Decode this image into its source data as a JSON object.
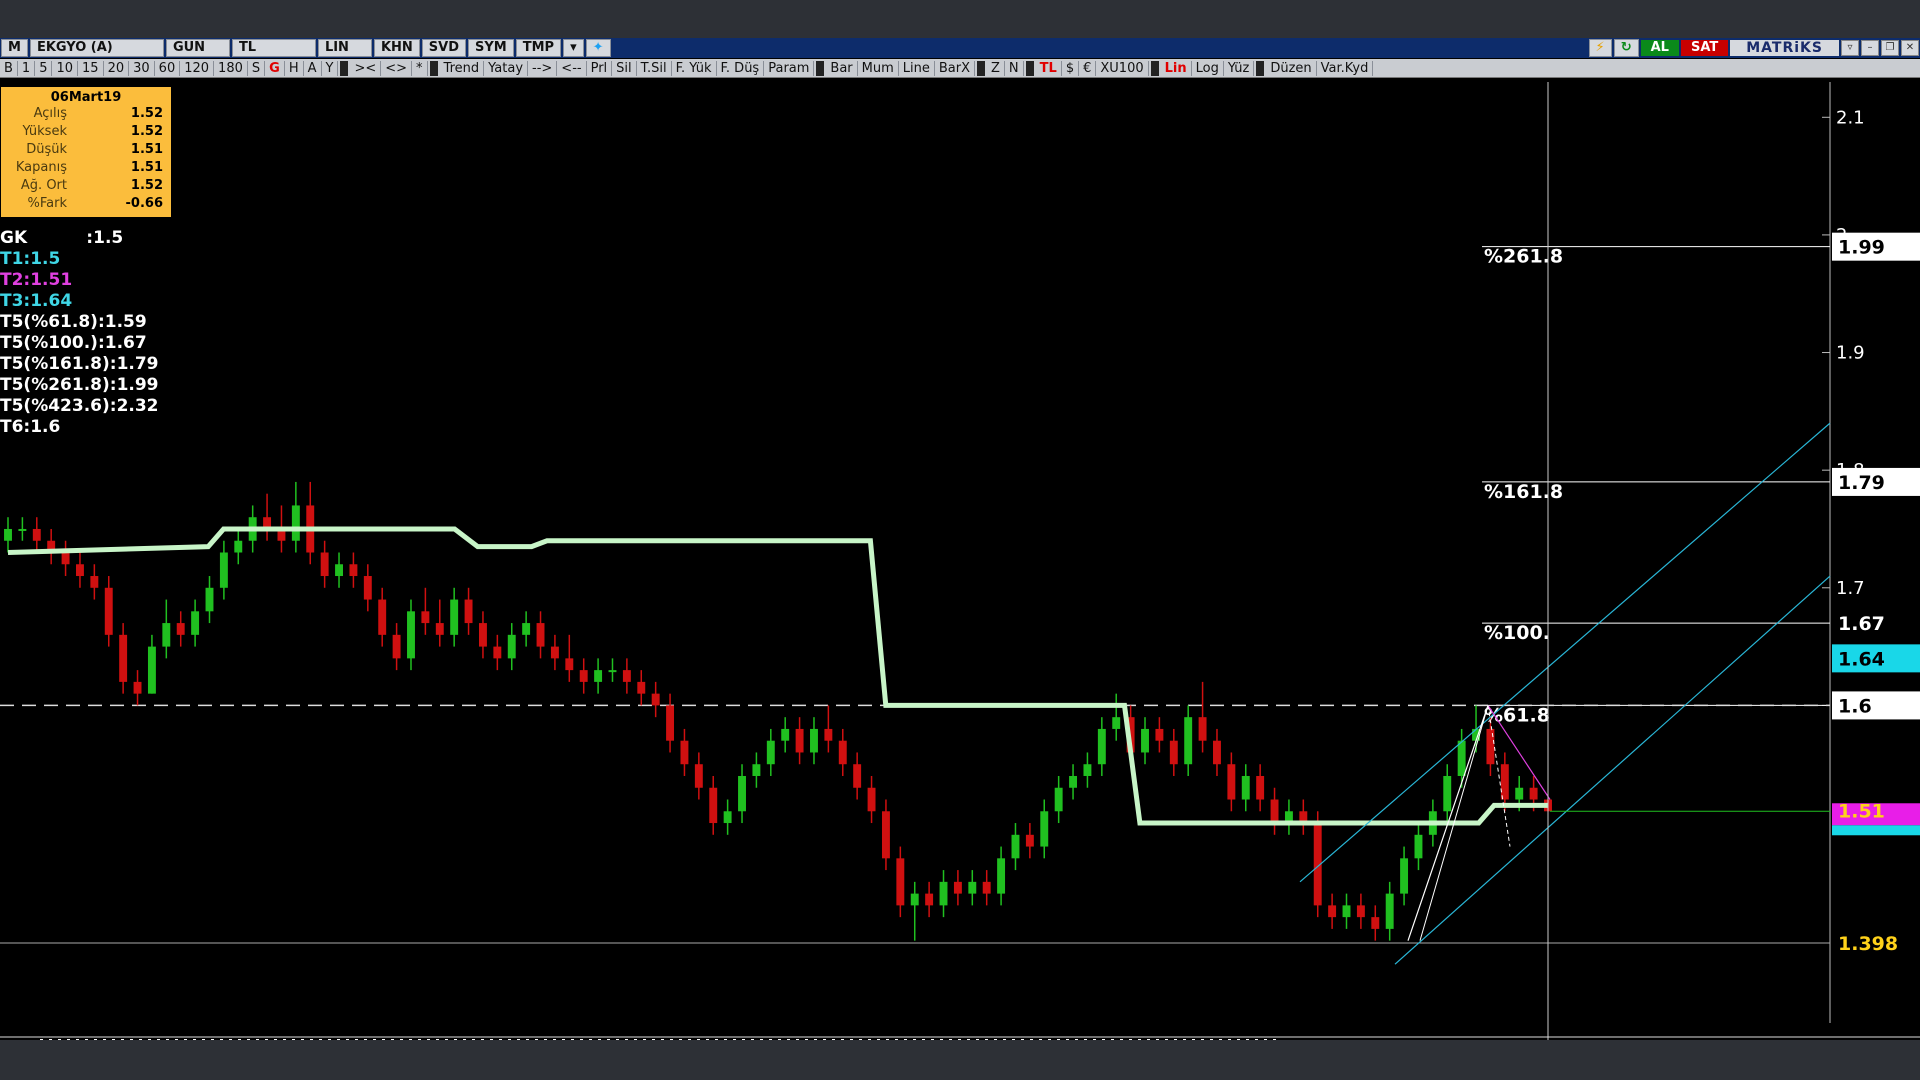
{
  "toolbar1": {
    "items": [
      "M",
      "EKGYO (A)",
      "GUN",
      "TL",
      "LIN",
      "KHN",
      "SVD",
      "SYM",
      "TMP"
    ],
    "al_label": "AL",
    "sat_label": "SAT",
    "logo": "MATRiKS"
  },
  "toolbar2": {
    "group1": [
      "B",
      "1",
      "5",
      "10",
      "15",
      "20",
      "30",
      "60",
      "120",
      "180",
      "S",
      "G",
      "H",
      "A",
      "Y"
    ],
    "group2": [
      "><",
      "<>",
      "*"
    ],
    "group3": [
      "Trend",
      "Yatay",
      "-->",
      "<--",
      "Prl",
      "Sil",
      "T.Sil",
      "F. Yük",
      "F. Düş",
      "Param"
    ],
    "group4": [
      "Bar",
      "Mum",
      "Line",
      "BarX"
    ],
    "group5": [
      "Z",
      "N"
    ],
    "group6": [
      "TL",
      "$",
      "€",
      "XU100"
    ],
    "group7": [
      "Lin",
      "Log",
      "Yüz"
    ],
    "group8": [
      "Düzen",
      "Var.Kyd"
    ]
  },
  "infobox": {
    "date": "06Mart19",
    "rows": [
      {
        "k": "Açılış",
        "v": "1.52"
      },
      {
        "k": "Yüksek",
        "v": "1.52"
      },
      {
        "k": "Düşük",
        "v": "1.51"
      },
      {
        "k": "Kapanış",
        "v": "1.51"
      },
      {
        "k": "Ağ. Ort",
        "v": "1.52"
      },
      {
        "k": "%Fark",
        "v": "-0.66"
      }
    ]
  },
  "indicators": [
    {
      "text": "GK          :1.5",
      "color": "#ffffff"
    },
    {
      "text": "T1:1.5",
      "color": "#3fd6e6"
    },
    {
      "text": "T2:1.51",
      "color": "#e040e0"
    },
    {
      "text": "T3:1.64",
      "color": "#3fd6e6"
    },
    {
      "text": "T5(%61.8):1.59",
      "color": "#ffffff"
    },
    {
      "text": "T5(%100.):1.67",
      "color": "#ffffff"
    },
    {
      "text": "T5(%161.8):1.79",
      "color": "#ffffff"
    },
    {
      "text": "T5(%261.8):1.99",
      "color": "#ffffff"
    },
    {
      "text": "T5(%423.6):2.32",
      "color": "#ffffff"
    },
    {
      "text": "T6:1.6",
      "color": "#ffffff"
    }
  ],
  "chart_data": {
    "type": "candlestick",
    "y_ticks": [
      2.1,
      2.0,
      1.9,
      1.8,
      1.7,
      1.6
    ],
    "y_tick_labels": [
      "2.1",
      "2",
      "1.9",
      "1.8",
      "1.7",
      "1.6"
    ],
    "ylim": [
      1.33,
      2.13
    ],
    "price_tags": [
      {
        "value": 1.99,
        "label": "1.99",
        "bg": "#ffffff",
        "fg": "#000000"
      },
      {
        "value": 1.79,
        "label": "1.79",
        "bg": "#ffffff",
        "fg": "#000000"
      },
      {
        "value": 1.67,
        "label": "1.67",
        "bg": "#000000",
        "fg": "#ffffff"
      },
      {
        "value": 1.64,
        "label": "1.64",
        "bg": "#19d7e8",
        "fg": "#000000"
      },
      {
        "value": 1.6,
        "label": "1.6",
        "bg": "#ffffff",
        "fg": "#000000"
      },
      {
        "value": 1.51,
        "label": "1.51",
        "bg": "#000000",
        "fg": "#ffd21a"
      },
      {
        "value": 1.398,
        "label": "1.398",
        "bg": "#000000",
        "fg": "#ffd21a"
      }
    ],
    "fib_levels": [
      {
        "label": "%261.8",
        "value": 1.99
      },
      {
        "label": "%161.8",
        "value": 1.79
      },
      {
        "label": "%100.",
        "value": 1.67
      },
      {
        "label": "%61.8",
        "value": 1.6
      }
    ],
    "candles": [
      {
        "o": 1.74,
        "h": 1.76,
        "l": 1.73,
        "c": 1.75
      },
      {
        "o": 1.75,
        "h": 1.76,
        "l": 1.74,
        "c": 1.75
      },
      {
        "o": 1.75,
        "h": 1.76,
        "l": 1.73,
        "c": 1.74
      },
      {
        "o": 1.74,
        "h": 1.75,
        "l": 1.72,
        "c": 1.73
      },
      {
        "o": 1.73,
        "h": 1.74,
        "l": 1.71,
        "c": 1.72
      },
      {
        "o": 1.72,
        "h": 1.73,
        "l": 1.7,
        "c": 1.71
      },
      {
        "o": 1.71,
        "h": 1.72,
        "l": 1.69,
        "c": 1.7
      },
      {
        "o": 1.7,
        "h": 1.71,
        "l": 1.65,
        "c": 1.66
      },
      {
        "o": 1.66,
        "h": 1.67,
        "l": 1.61,
        "c": 1.62
      },
      {
        "o": 1.62,
        "h": 1.63,
        "l": 1.6,
        "c": 1.61
      },
      {
        "o": 1.61,
        "h": 1.66,
        "l": 1.61,
        "c": 1.65
      },
      {
        "o": 1.65,
        "h": 1.69,
        "l": 1.64,
        "c": 1.67
      },
      {
        "o": 1.67,
        "h": 1.68,
        "l": 1.65,
        "c": 1.66
      },
      {
        "o": 1.66,
        "h": 1.69,
        "l": 1.65,
        "c": 1.68
      },
      {
        "o": 1.68,
        "h": 1.71,
        "l": 1.67,
        "c": 1.7
      },
      {
        "o": 1.7,
        "h": 1.74,
        "l": 1.69,
        "c": 1.73
      },
      {
        "o": 1.73,
        "h": 1.75,
        "l": 1.72,
        "c": 1.74
      },
      {
        "o": 1.74,
        "h": 1.77,
        "l": 1.73,
        "c": 1.76
      },
      {
        "o": 1.76,
        "h": 1.78,
        "l": 1.74,
        "c": 1.75
      },
      {
        "o": 1.75,
        "h": 1.77,
        "l": 1.73,
        "c": 1.74
      },
      {
        "o": 1.74,
        "h": 1.79,
        "l": 1.73,
        "c": 1.77
      },
      {
        "o": 1.77,
        "h": 1.79,
        "l": 1.72,
        "c": 1.73
      },
      {
        "o": 1.73,
        "h": 1.74,
        "l": 1.7,
        "c": 1.71
      },
      {
        "o": 1.71,
        "h": 1.73,
        "l": 1.7,
        "c": 1.72
      },
      {
        "o": 1.72,
        "h": 1.73,
        "l": 1.7,
        "c": 1.71
      },
      {
        "o": 1.71,
        "h": 1.72,
        "l": 1.68,
        "c": 1.69
      },
      {
        "o": 1.69,
        "h": 1.7,
        "l": 1.65,
        "c": 1.66
      },
      {
        "o": 1.66,
        "h": 1.67,
        "l": 1.63,
        "c": 1.64
      },
      {
        "o": 1.64,
        "h": 1.69,
        "l": 1.63,
        "c": 1.68
      },
      {
        "o": 1.68,
        "h": 1.7,
        "l": 1.66,
        "c": 1.67
      },
      {
        "o": 1.67,
        "h": 1.69,
        "l": 1.65,
        "c": 1.66
      },
      {
        "o": 1.66,
        "h": 1.7,
        "l": 1.65,
        "c": 1.69
      },
      {
        "o": 1.69,
        "h": 1.7,
        "l": 1.66,
        "c": 1.67
      },
      {
        "o": 1.67,
        "h": 1.68,
        "l": 1.64,
        "c": 1.65
      },
      {
        "o": 1.65,
        "h": 1.66,
        "l": 1.63,
        "c": 1.64
      },
      {
        "o": 1.64,
        "h": 1.67,
        "l": 1.63,
        "c": 1.66
      },
      {
        "o": 1.66,
        "h": 1.68,
        "l": 1.65,
        "c": 1.67
      },
      {
        "o": 1.67,
        "h": 1.68,
        "l": 1.64,
        "c": 1.65
      },
      {
        "o": 1.65,
        "h": 1.66,
        "l": 1.63,
        "c": 1.64
      },
      {
        "o": 1.64,
        "h": 1.66,
        "l": 1.62,
        "c": 1.63
      },
      {
        "o": 1.63,
        "h": 1.64,
        "l": 1.61,
        "c": 1.62
      },
      {
        "o": 1.62,
        "h": 1.64,
        "l": 1.61,
        "c": 1.63
      },
      {
        "o": 1.63,
        "h": 1.64,
        "l": 1.62,
        "c": 1.63
      },
      {
        "o": 1.63,
        "h": 1.64,
        "l": 1.61,
        "c": 1.62
      },
      {
        "o": 1.62,
        "h": 1.63,
        "l": 1.6,
        "c": 1.61
      },
      {
        "o": 1.61,
        "h": 1.62,
        "l": 1.59,
        "c": 1.6
      },
      {
        "o": 1.6,
        "h": 1.61,
        "l": 1.56,
        "c": 1.57
      },
      {
        "o": 1.57,
        "h": 1.58,
        "l": 1.54,
        "c": 1.55
      },
      {
        "o": 1.55,
        "h": 1.56,
        "l": 1.52,
        "c": 1.53
      },
      {
        "o": 1.53,
        "h": 1.54,
        "l": 1.49,
        "c": 1.5
      },
      {
        "o": 1.5,
        "h": 1.52,
        "l": 1.49,
        "c": 1.51
      },
      {
        "o": 1.51,
        "h": 1.55,
        "l": 1.5,
        "c": 1.54
      },
      {
        "o": 1.54,
        "h": 1.56,
        "l": 1.53,
        "c": 1.55
      },
      {
        "o": 1.55,
        "h": 1.58,
        "l": 1.54,
        "c": 1.57
      },
      {
        "o": 1.57,
        "h": 1.59,
        "l": 1.56,
        "c": 1.58
      },
      {
        "o": 1.58,
        "h": 1.59,
        "l": 1.55,
        "c": 1.56
      },
      {
        "o": 1.56,
        "h": 1.59,
        "l": 1.55,
        "c": 1.58
      },
      {
        "o": 1.58,
        "h": 1.6,
        "l": 1.56,
        "c": 1.57
      },
      {
        "o": 1.57,
        "h": 1.58,
        "l": 1.54,
        "c": 1.55
      },
      {
        "o": 1.55,
        "h": 1.56,
        "l": 1.52,
        "c": 1.53
      },
      {
        "o": 1.53,
        "h": 1.54,
        "l": 1.5,
        "c": 1.51
      },
      {
        "o": 1.51,
        "h": 1.52,
        "l": 1.46,
        "c": 1.47
      },
      {
        "o": 1.47,
        "h": 1.48,
        "l": 1.42,
        "c": 1.43
      },
      {
        "o": 1.43,
        "h": 1.45,
        "l": 1.4,
        "c": 1.44
      },
      {
        "o": 1.44,
        "h": 1.45,
        "l": 1.42,
        "c": 1.43
      },
      {
        "o": 1.43,
        "h": 1.46,
        "l": 1.42,
        "c": 1.45
      },
      {
        "o": 1.45,
        "h": 1.46,
        "l": 1.43,
        "c": 1.44
      },
      {
        "o": 1.44,
        "h": 1.46,
        "l": 1.43,
        "c": 1.45
      },
      {
        "o": 1.45,
        "h": 1.46,
        "l": 1.43,
        "c": 1.44
      },
      {
        "o": 1.44,
        "h": 1.48,
        "l": 1.43,
        "c": 1.47
      },
      {
        "o": 1.47,
        "h": 1.5,
        "l": 1.46,
        "c": 1.49
      },
      {
        "o": 1.49,
        "h": 1.5,
        "l": 1.47,
        "c": 1.48
      },
      {
        "o": 1.48,
        "h": 1.52,
        "l": 1.47,
        "c": 1.51
      },
      {
        "o": 1.51,
        "h": 1.54,
        "l": 1.5,
        "c": 1.53
      },
      {
        "o": 1.53,
        "h": 1.55,
        "l": 1.52,
        "c": 1.54
      },
      {
        "o": 1.54,
        "h": 1.56,
        "l": 1.53,
        "c": 1.55
      },
      {
        "o": 1.55,
        "h": 1.59,
        "l": 1.54,
        "c": 1.58
      },
      {
        "o": 1.58,
        "h": 1.61,
        "l": 1.57,
        "c": 1.59
      },
      {
        "o": 1.59,
        "h": 1.6,
        "l": 1.55,
        "c": 1.56
      },
      {
        "o": 1.56,
        "h": 1.59,
        "l": 1.55,
        "c": 1.58
      },
      {
        "o": 1.58,
        "h": 1.59,
        "l": 1.56,
        "c": 1.57
      },
      {
        "o": 1.57,
        "h": 1.58,
        "l": 1.54,
        "c": 1.55
      },
      {
        "o": 1.55,
        "h": 1.6,
        "l": 1.54,
        "c": 1.59
      },
      {
        "o": 1.59,
        "h": 1.62,
        "l": 1.56,
        "c": 1.57
      },
      {
        "o": 1.57,
        "h": 1.58,
        "l": 1.54,
        "c": 1.55
      },
      {
        "o": 1.55,
        "h": 1.56,
        "l": 1.51,
        "c": 1.52
      },
      {
        "o": 1.52,
        "h": 1.55,
        "l": 1.51,
        "c": 1.54
      },
      {
        "o": 1.54,
        "h": 1.55,
        "l": 1.51,
        "c": 1.52
      },
      {
        "o": 1.52,
        "h": 1.53,
        "l": 1.49,
        "c": 1.5
      },
      {
        "o": 1.5,
        "h": 1.52,
        "l": 1.49,
        "c": 1.51
      },
      {
        "o": 1.51,
        "h": 1.52,
        "l": 1.49,
        "c": 1.5
      },
      {
        "o": 1.5,
        "h": 1.51,
        "l": 1.42,
        "c": 1.43
      },
      {
        "o": 1.43,
        "h": 1.44,
        "l": 1.41,
        "c": 1.42
      },
      {
        "o": 1.42,
        "h": 1.44,
        "l": 1.41,
        "c": 1.43
      },
      {
        "o": 1.43,
        "h": 1.44,
        "l": 1.41,
        "c": 1.42
      },
      {
        "o": 1.42,
        "h": 1.43,
        "l": 1.4,
        "c": 1.41
      },
      {
        "o": 1.41,
        "h": 1.45,
        "l": 1.4,
        "c": 1.44
      },
      {
        "o": 1.44,
        "h": 1.48,
        "l": 1.43,
        "c": 1.47
      },
      {
        "o": 1.47,
        "h": 1.5,
        "l": 1.46,
        "c": 1.49
      },
      {
        "o": 1.49,
        "h": 1.52,
        "l": 1.48,
        "c": 1.51
      },
      {
        "o": 1.51,
        "h": 1.55,
        "l": 1.5,
        "c": 1.54
      },
      {
        "o": 1.54,
        "h": 1.58,
        "l": 1.53,
        "c": 1.57
      },
      {
        "o": 1.57,
        "h": 1.6,
        "l": 1.56,
        "c": 1.58
      },
      {
        "o": 1.58,
        "h": 1.59,
        "l": 1.54,
        "c": 1.55
      },
      {
        "o": 1.55,
        "h": 1.56,
        "l": 1.51,
        "c": 1.52
      },
      {
        "o": 1.52,
        "h": 1.54,
        "l": 1.51,
        "c": 1.53
      },
      {
        "o": 1.53,
        "h": 1.54,
        "l": 1.51,
        "c": 1.52
      },
      {
        "o": 1.52,
        "h": 1.52,
        "l": 1.51,
        "c": 1.51
      }
    ],
    "stop_line_color": "#c8f5c8",
    "bullish_color": "#20c020",
    "bearish_color": "#d01010",
    "cursor_date": "06Mart19"
  }
}
